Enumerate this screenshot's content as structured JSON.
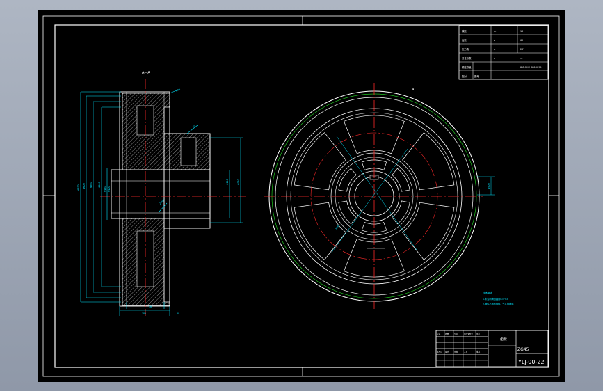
{
  "drawing": {
    "section_label": "A—A",
    "view_label": "A",
    "notes_title": "技术要求",
    "notes": [
      "1.未注明铸造圆角R3~R5",
      "2.铸件不得有砂眼、气孔等缺陷"
    ]
  },
  "param_table": {
    "rows": [
      [
        "模数",
        "m",
        "10"
      ],
      [
        "齿数",
        "z",
        "62"
      ],
      [
        "压力角",
        "α",
        "20°"
      ],
      [
        "变位系数",
        "x",
        "—"
      ],
      [
        "精度等级",
        "",
        "8-8-7HK GB10095"
      ],
      [
        "配对",
        "图号",
        ""
      ]
    ]
  },
  "title_block": {
    "drawing_no": "YLJ-00-22",
    "material": "ZG45",
    "part_name": "齿轮",
    "small_cells": [
      "标记",
      "处数",
      "分区",
      "更改文件号",
      "签名",
      "年月日",
      "设计",
      "审核",
      "工艺",
      "批准"
    ]
  },
  "dims": {
    "left": [
      "Φ620",
      "Φ600",
      "Φ560",
      "Φ400",
      "Φ160",
      "Φ100"
    ],
    "right": [
      "Φ260",
      "Φ140"
    ],
    "bottom": [
      "180",
      "56",
      "30"
    ],
    "small": [
      "C2",
      "R5",
      "2x45°"
    ],
    "front": [
      "Φ300",
      "R10"
    ]
  },
  "colors": {
    "line": "#ffffff",
    "center": "#ff2a2a",
    "dim": "#00e5ff",
    "hatch": "#7a7a7a",
    "green": "#1fc41f"
  }
}
